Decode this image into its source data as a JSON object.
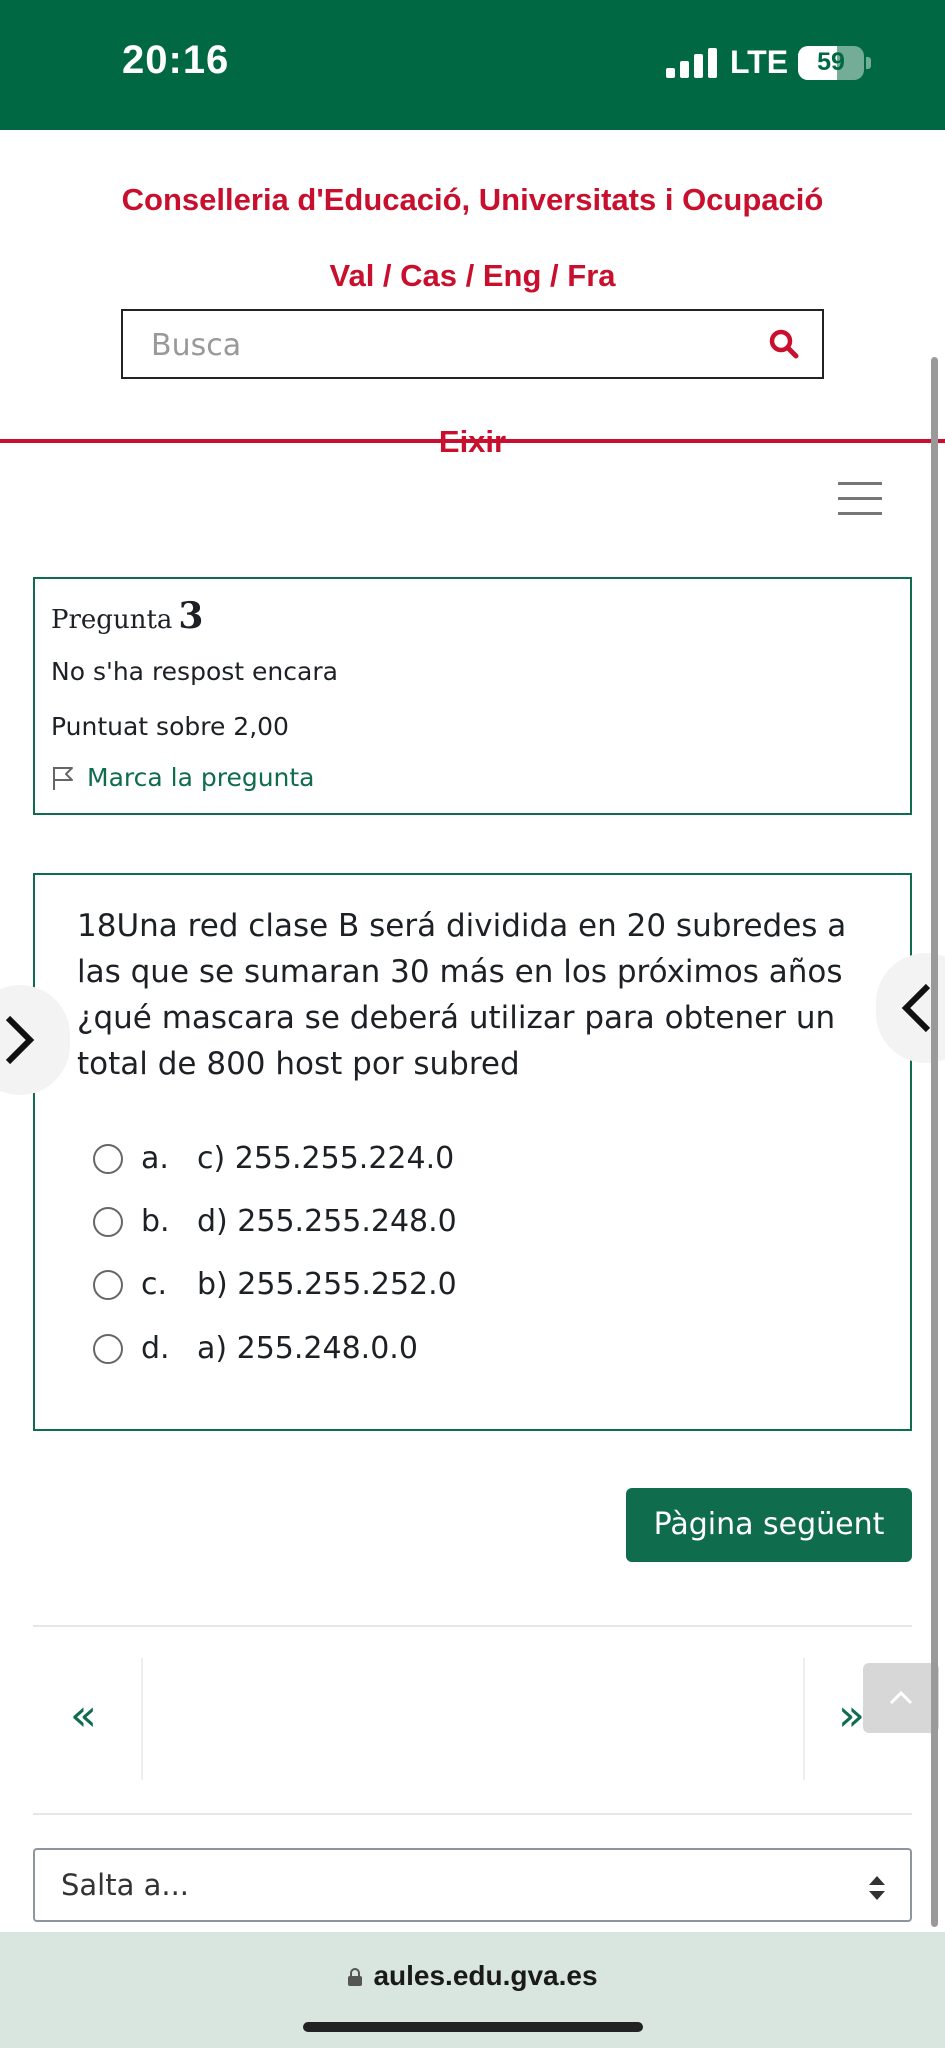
{
  "status_bar": {
    "time": "20:16",
    "network": "LTE",
    "battery": "59"
  },
  "header": {
    "org_name": "Conselleria d'Educació, Universitats i Ocupació",
    "languages": "Val / Cas / Eng / Fra",
    "search_placeholder": "Busca",
    "logout_label": "Eixir",
    "accent_color": "#c8102e"
  },
  "question_info": {
    "label": "Pregunta",
    "number": "3",
    "status": "No s'ha respost encara",
    "grade": "Puntuat sobre 2,00",
    "flag_label": "Marca la pregunta"
  },
  "question": {
    "text": "18Una red clase B será dividida en 20 subredes a las que se sumaran 30 más en los próximos años ¿qué mascara se deberá utilizar para obtener un total de 800 host por subred",
    "options": [
      {
        "letter": "a.",
        "text": "c) 255.255.224.0"
      },
      {
        "letter": "b.",
        "text": "d) 255.255.248.0"
      },
      {
        "letter": "c.",
        "text": "b) 255.255.252.0"
      },
      {
        "letter": "d.",
        "text": "a) 255.248.0.0"
      }
    ]
  },
  "nav": {
    "next_page_label": "Pàgina següent",
    "first_symbol": "«",
    "last_symbol": "»",
    "jump_label": "Salta a...",
    "theme_color": "#0f6c4d"
  },
  "browser": {
    "url": "aules.edu.gva.es"
  }
}
